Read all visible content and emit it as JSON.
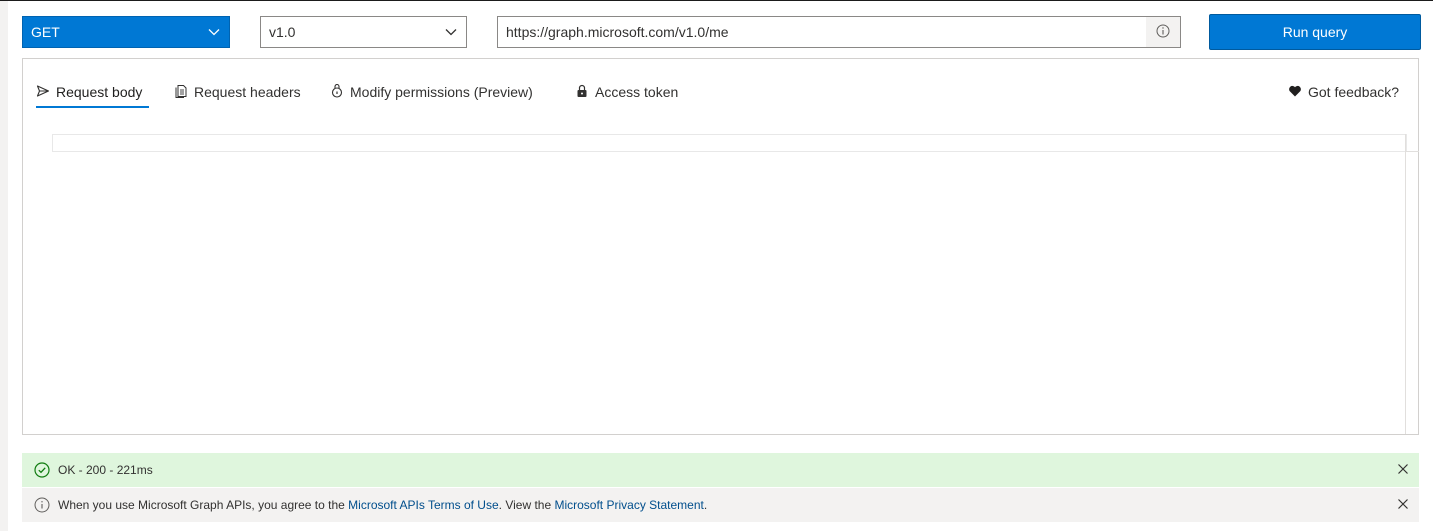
{
  "query_bar": {
    "method": "GET",
    "version": "v1.0",
    "url": "https://graph.microsoft.com/v1.0/me",
    "run_label": "Run query"
  },
  "tabs": [
    {
      "label": "Request body",
      "icon": "send-icon",
      "active": true
    },
    {
      "label": "Request headers",
      "icon": "document-icon",
      "active": false
    },
    {
      "label": "Modify permissions (Preview)",
      "icon": "permissions-icon",
      "active": false
    },
    {
      "label": "Access token",
      "icon": "lock-icon",
      "active": false
    }
  ],
  "feedback": {
    "label": "Got feedback?",
    "icon": "heart-icon"
  },
  "status": {
    "text": "OK - 200 - 221ms",
    "icon": "check-circle-icon"
  },
  "notice": {
    "prefix": "When you use Microsoft Graph APIs, you agree to the ",
    "terms_link": "Microsoft APIs Terms of Use",
    "middle": ". View the ",
    "privacy_link": "Microsoft Privacy Statement",
    "suffix": ".",
    "icon": "info-icon"
  },
  "colors": {
    "accent": "#0078d4",
    "success_bg": "#dff6dd",
    "info_bg": "#f3f2f1",
    "link": "#004e8c"
  }
}
